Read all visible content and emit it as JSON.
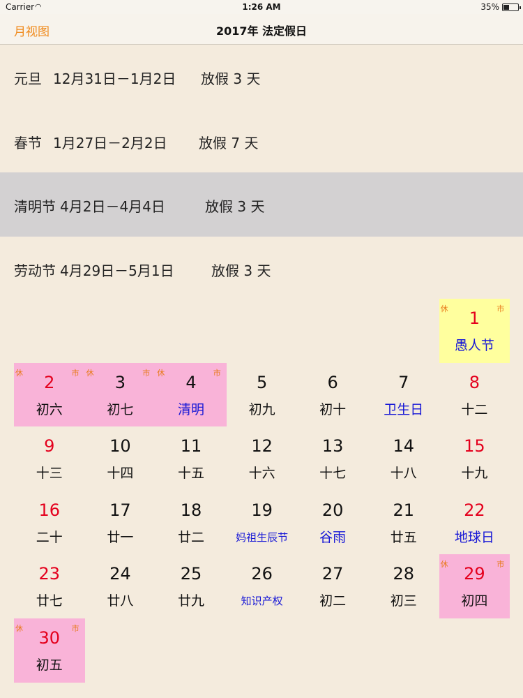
{
  "status_bar": {
    "carrier": "Carrier",
    "time": "1:26 AM",
    "battery": "35%",
    "battery_level": 0.35
  },
  "nav": {
    "back_label": "月视图",
    "title": "2017年  法定假日"
  },
  "holidays": [
    {
      "name": "元旦",
      "range": "12月31日－1月2日",
      "days": "放假 3 天",
      "selected": false
    },
    {
      "name": "春节",
      "range": "1月27日－2月2日",
      "days": "放假 7 天",
      "selected": false
    },
    {
      "name": "清明节",
      "range": "4月2日－4月4日",
      "days": "放假 3 天",
      "selected": true
    },
    {
      "name": "劳动节",
      "range": "4月29日－5月1日",
      "days": "放假 3 天",
      "selected": false
    }
  ],
  "calendar": {
    "tags": {
      "rest": "休",
      "market": "市"
    },
    "colors": {
      "weekend_red": "#e4001d",
      "festival_blue": "#1818d6",
      "holiday_pink": "#f9b3d8",
      "today_yellow": "#ffff9e",
      "tag_orange": "#e87a1a"
    },
    "weeks": [
      [
        null,
        null,
        null,
        null,
        null,
        null,
        {
          "day": "1",
          "sub": "愚人节",
          "red": true,
          "blue": true,
          "bg": "yellow",
          "tags": true
        }
      ],
      [
        {
          "day": "2",
          "sub": "初六",
          "red": true,
          "bg": "pink",
          "tags": true
        },
        {
          "day": "3",
          "sub": "初七",
          "bg": "pink",
          "tags": true
        },
        {
          "day": "4",
          "sub": "清明",
          "blue": true,
          "bg": "pink",
          "tags": true
        },
        {
          "day": "5",
          "sub": "初九"
        },
        {
          "day": "6",
          "sub": "初十"
        },
        {
          "day": "7",
          "sub": "卫生日",
          "blue": true
        },
        {
          "day": "8",
          "sub": "十二",
          "red": true
        }
      ],
      [
        {
          "day": "9",
          "sub": "十三",
          "red": true
        },
        {
          "day": "10",
          "sub": "十四"
        },
        {
          "day": "11",
          "sub": "十五"
        },
        {
          "day": "12",
          "sub": "十六"
        },
        {
          "day": "13",
          "sub": "十七"
        },
        {
          "day": "14",
          "sub": "十八"
        },
        {
          "day": "15",
          "sub": "十九",
          "red": true
        }
      ],
      [
        {
          "day": "16",
          "sub": "二十",
          "red": true
        },
        {
          "day": "17",
          "sub": "廿一"
        },
        {
          "day": "18",
          "sub": "廿二"
        },
        {
          "day": "19",
          "sub": "妈祖生辰节",
          "blue": true,
          "small": true
        },
        {
          "day": "20",
          "sub": "谷雨",
          "blue": true
        },
        {
          "day": "21",
          "sub": "廿五"
        },
        {
          "day": "22",
          "sub": "地球日",
          "red": true,
          "blue": true
        }
      ],
      [
        {
          "day": "23",
          "sub": "廿七",
          "red": true
        },
        {
          "day": "24",
          "sub": "廿八"
        },
        {
          "day": "25",
          "sub": "廿九"
        },
        {
          "day": "26",
          "sub": "知识产权",
          "blue": true,
          "small": true
        },
        {
          "day": "27",
          "sub": "初二"
        },
        {
          "day": "28",
          "sub": "初三"
        },
        {
          "day": "29",
          "sub": "初四",
          "red": true,
          "bg": "pink",
          "tags": true
        }
      ],
      [
        {
          "day": "30",
          "sub": "初五",
          "red": true,
          "bg": "pink",
          "tags": true
        },
        null,
        null,
        null,
        null,
        null,
        null
      ]
    ]
  }
}
